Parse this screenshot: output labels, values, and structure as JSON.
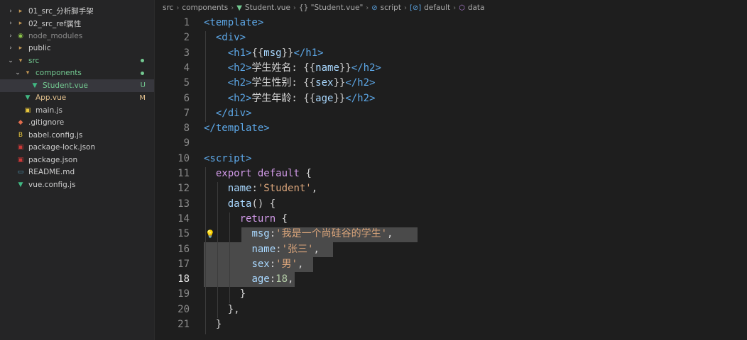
{
  "explorer": {
    "items": [
      {
        "name": "01_src_分析脚手架",
        "chevron": "›",
        "icon": "folder-icon",
        "color": "#cccccc",
        "indent": 0
      },
      {
        "name": "02_src_ref属性",
        "chevron": "›",
        "icon": "folder-icon",
        "color": "#cccccc",
        "indent": 0
      },
      {
        "name": "node_modules",
        "chevron": "›",
        "icon": "node-modules-icon",
        "color": "#8c8c8c",
        "indent": 0
      },
      {
        "name": "public",
        "chevron": "›",
        "icon": "folder-icon",
        "color": "#cccccc",
        "indent": 0
      },
      {
        "name": "src",
        "chevron": "⌄",
        "icon": "folder-open-icon",
        "color": "#73c991",
        "indent": 0,
        "dot": true
      },
      {
        "name": "components",
        "chevron": "⌄",
        "icon": "folder-open-icon",
        "color": "#73c991",
        "indent": 1,
        "dot": true
      },
      {
        "name": "Student.vue",
        "chevron": "",
        "icon": "vue-file-icon",
        "color": "#73c991",
        "indent": 2,
        "badge": "U",
        "selected": true
      },
      {
        "name": "App.vue",
        "chevron": "",
        "icon": "vue-file-icon",
        "color": "#e2c08d",
        "indent": 1,
        "badge": "M"
      },
      {
        "name": "main.js",
        "chevron": "",
        "icon": "js-file-icon",
        "color": "#cccccc",
        "indent": 1
      },
      {
        "name": ".gitignore",
        "chevron": "",
        "icon": "git-icon",
        "color": "#cccccc",
        "indent": 0
      },
      {
        "name": "babel.config.js",
        "chevron": "",
        "icon": "babel-icon",
        "color": "#cccccc",
        "indent": 0
      },
      {
        "name": "package-lock.json",
        "chevron": "",
        "icon": "npm-icon",
        "color": "#cccccc",
        "indent": 0
      },
      {
        "name": "package.json",
        "chevron": "",
        "icon": "npm-icon",
        "color": "#cccccc",
        "indent": 0
      },
      {
        "name": "README.md",
        "chevron": "",
        "icon": "markdown-icon",
        "color": "#cccccc",
        "indent": 0
      },
      {
        "name": "vue.config.js",
        "chevron": "",
        "icon": "vue-file-icon",
        "color": "#cccccc",
        "indent": 0
      }
    ]
  },
  "breadcrumb": {
    "src": "src",
    "components": "components",
    "file": "Student.vue",
    "section": "{} \"Student.vue\"",
    "script": "script",
    "default": "default",
    "data": "data"
  },
  "code_lines": [
    {
      "n": "1",
      "tokens": [
        [
          "tag",
          "<template>"
        ]
      ]
    },
    {
      "n": "2",
      "tokens": [
        [
          "plain",
          "  "
        ],
        [
          "tag",
          "<div>"
        ]
      ]
    },
    {
      "n": "3",
      "tokens": [
        [
          "plain",
          "    "
        ],
        [
          "tag",
          "<h1>"
        ],
        [
          "br",
          "{{"
        ],
        [
          "prop",
          "msg"
        ],
        [
          "br",
          "}}"
        ],
        [
          "tag",
          "</h1>"
        ]
      ]
    },
    {
      "n": "4",
      "tokens": [
        [
          "plain",
          "    "
        ],
        [
          "tag",
          "<h2>"
        ],
        [
          "plain",
          "学生姓名: "
        ],
        [
          "br",
          "{{"
        ],
        [
          "prop",
          "name"
        ],
        [
          "br",
          "}}"
        ],
        [
          "tag",
          "</h2>"
        ]
      ]
    },
    {
      "n": "5",
      "tokens": [
        [
          "plain",
          "    "
        ],
        [
          "tag",
          "<h2>"
        ],
        [
          "plain",
          "学生性别: "
        ],
        [
          "br",
          "{{"
        ],
        [
          "prop",
          "sex"
        ],
        [
          "br",
          "}}"
        ],
        [
          "tag",
          "</h2>"
        ]
      ]
    },
    {
      "n": "6",
      "tokens": [
        [
          "plain",
          "    "
        ],
        [
          "tag",
          "<h2>"
        ],
        [
          "plain",
          "学生年龄: "
        ],
        [
          "br",
          "{{"
        ],
        [
          "prop",
          "age"
        ],
        [
          "br",
          "}}"
        ],
        [
          "tag",
          "</h2>"
        ]
      ]
    },
    {
      "n": "7",
      "tokens": [
        [
          "plain",
          "  "
        ],
        [
          "tag",
          "</div>"
        ]
      ]
    },
    {
      "n": "8",
      "tokens": [
        [
          "tag",
          "</template>"
        ]
      ]
    },
    {
      "n": "9",
      "tokens": []
    },
    {
      "n": "10",
      "tokens": [
        [
          "tag",
          "<script>"
        ]
      ]
    },
    {
      "n": "11",
      "tokens": [
        [
          "plain",
          "  "
        ],
        [
          "kw",
          "export"
        ],
        [
          "plain",
          " "
        ],
        [
          "kw",
          "default"
        ],
        [
          "plain",
          " {"
        ]
      ]
    },
    {
      "n": "12",
      "tokens": [
        [
          "plain",
          "    "
        ],
        [
          "prop",
          "name"
        ],
        [
          "plain",
          ":"
        ],
        [
          "str",
          "'Student'"
        ],
        [
          "plain",
          ","
        ]
      ]
    },
    {
      "n": "13",
      "tokens": [
        [
          "plain",
          "    "
        ],
        [
          "prop",
          "data"
        ],
        [
          "plain",
          "() {"
        ]
      ]
    },
    {
      "n": "14",
      "tokens": [
        [
          "plain",
          "      "
        ],
        [
          "kw",
          "return"
        ],
        [
          "plain",
          " {"
        ]
      ]
    },
    {
      "n": "15",
      "tokens": [
        [
          "plain",
          "        "
        ],
        [
          "prop",
          "msg"
        ],
        [
          "plain",
          ":"
        ],
        [
          "str",
          "'我是一个尚硅谷的学生'"
        ],
        [
          "plain",
          ","
        ]
      ]
    },
    {
      "n": "16",
      "tokens": [
        [
          "plain",
          "        "
        ],
        [
          "prop",
          "name"
        ],
        [
          "plain",
          ":"
        ],
        [
          "str",
          "'张三'"
        ],
        [
          "plain",
          ","
        ]
      ]
    },
    {
      "n": "17",
      "tokens": [
        [
          "plain",
          "        "
        ],
        [
          "prop",
          "sex"
        ],
        [
          "plain",
          ":"
        ],
        [
          "str",
          "'男'"
        ],
        [
          "plain",
          ","
        ]
      ]
    },
    {
      "n": "18",
      "tokens": [
        [
          "plain",
          "        "
        ],
        [
          "prop",
          "age"
        ],
        [
          "plain",
          ":"
        ],
        [
          "num",
          "18"
        ],
        [
          "plain",
          ","
        ]
      ]
    },
    {
      "n": "19",
      "tokens": [
        [
          "plain",
          "      }"
        ]
      ]
    },
    {
      "n": "20",
      "tokens": [
        [
          "plain",
          "    },"
        ]
      ]
    },
    {
      "n": "21",
      "tokens": [
        [
          "plain",
          "  }"
        ]
      ]
    }
  ],
  "active_line": "18",
  "colors": {
    "accent_green": "#73c991",
    "modified_yellow": "#e2c08d",
    "tag_blue": "#5da8e8",
    "keyword_purple": "#d19ae8",
    "string_orange": "#d9a47a"
  }
}
